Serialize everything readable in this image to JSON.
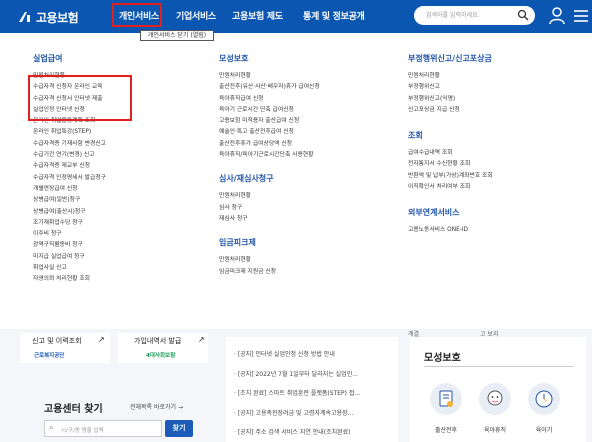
{
  "header": {
    "logo_text": "고용보험",
    "nav": [
      "개인서비스",
      "기업서비스",
      "고용보험 제도",
      "통계 및 정보공개"
    ],
    "search_placeholder": "검색어를 입력하세요.",
    "tooltip": "개인서비스 닫기 (열림)"
  },
  "menu": {
    "col1": {
      "title": "실업급여",
      "items": [
        "민원처리현황",
        "수급자격 신청자 온라인 교육",
        "수급자격 신청서 인터넷 제출",
        "실업인정 인터넷 신청",
        "온라인 취업활동계획 조회",
        "온라인 취업특강(STEP)",
        "수급자격증 기재사항 변경신고",
        "수급기간 연기(변경) 신고",
        "수급자격증 재교부 신청",
        "수급자격 인정명세서 발급청구",
        "개별연장급여 신청",
        "상병급여(일반)청구",
        "상병급여(출산시)청구",
        "조기재취업수당 청구",
        "이주비 청구",
        "광역구직활동비 청구",
        "미지급 실업급여 청구",
        "취업사실 신고",
        "자영의뢰 처리현황 조회"
      ]
    },
    "col2": {
      "title": "모성보호",
      "items": [
        "민원처리현황",
        "출산전후(유산·사산·배우자)휴가 급여신청",
        "육아휴직급여 신청",
        "육아기 근로시간 단축 급여신청",
        "고용보험 미적용자 출산급여 신청",
        "예술인·특고 출산전후급여 신청",
        "출산전후휴가 급여상당액 신청",
        "육아휴직/육아기근로시간단축 사용현황"
      ],
      "title2": "심사/재심사청구",
      "items2": [
        "민원처리현황",
        "심사 청구",
        "재심사 청구"
      ],
      "title3": "임금피크제",
      "items3": [
        "민원처리현황",
        "임금피크제 지원금 신청"
      ]
    },
    "col3": {
      "title": "부정행위신고/신고포상금",
      "items": [
        "민원처리현황",
        "부정행위신고",
        "부정행위신고(익명)",
        "신고포상금 지급 신청"
      ],
      "title2": "조회",
      "items2": [
        "급여수급내역 조회",
        "전자통지서 수신현황 조회",
        "반환액 및 납부(가상)계좌번호 조회",
        "이직확인서 처리여부 조회"
      ],
      "title3": "외부연계서비스",
      "items3": [
        "고용노동서비스 ONE-ID"
      ]
    }
  },
  "bottom": {
    "links": [
      "신고 및 이력조회",
      "가입내역서 발급"
    ],
    "orgs": [
      "근로복지공단",
      "4대사회보험"
    ],
    "center_title": "고용센터 찾기",
    "center_more": "전체목록 바로가기",
    "center_placeholder": "시/구/동 명을 입력",
    "center_button": "찾기",
    "news": [
      "[공지] 인터넷 실업인정 신청 방법 안내",
      "[공지] 2022년 7월 1일부터 달라지는 실업인...",
      "[조치 완료] 스마트 취업훈련 플랫폼(STEP) 접...",
      "[공지] 고용촉진장려금 및 고령자계속고용장...",
      "[공지] 주소 검색 서비스 지연 안내(조치완료)"
    ],
    "maternity_title": "모성보호",
    "maternity_items": [
      "출산전후",
      "육아휴직",
      "육아기"
    ],
    "cut_labels": [
      "계결",
      "고 보지"
    ]
  }
}
